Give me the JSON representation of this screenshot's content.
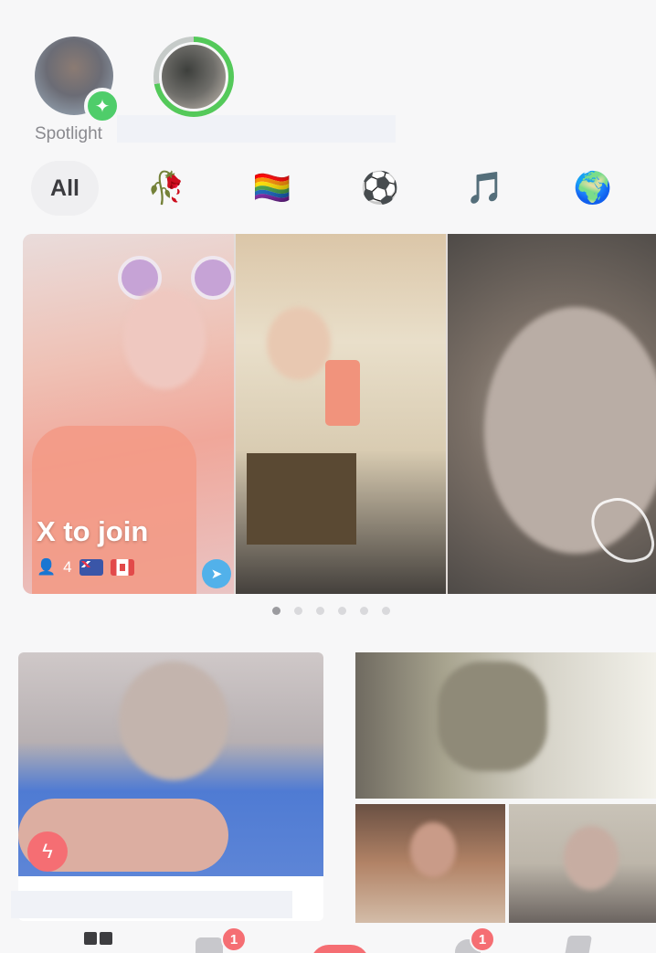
{
  "stories": [
    {
      "label": "Spotlight",
      "badge_icon": "sparkle-icon"
    },
    {
      "label": "",
      "ring_color": "#54c95a"
    }
  ],
  "filters": [
    {
      "label": "All",
      "selected": true
    },
    {
      "icon": "wilted-rose-icon",
      "glyph": "🥀"
    },
    {
      "icon": "rainbow-flag-icon",
      "glyph": "🏳️‍🌈"
    },
    {
      "icon": "soccer-ball-icon",
      "glyph": "⚽"
    },
    {
      "icon": "music-note-icon",
      "glyph": "🎵"
    },
    {
      "icon": "globe-icon",
      "glyph": "🌍"
    }
  ],
  "featured": {
    "title": "X to join",
    "member_count": "4",
    "flags": [
      "flag-australia-icon",
      "flag-canada-icon"
    ]
  },
  "carousel": {
    "page_count": 6,
    "current_page": 1
  },
  "tabbar": {
    "chat_badge": "1",
    "notifications_badge": "1"
  },
  "colors": {
    "accent": "#f56e73",
    "story_ring": "#54c95a",
    "spotlight_badge": "#4fcd6a",
    "send_badge": "#52b1ea"
  }
}
